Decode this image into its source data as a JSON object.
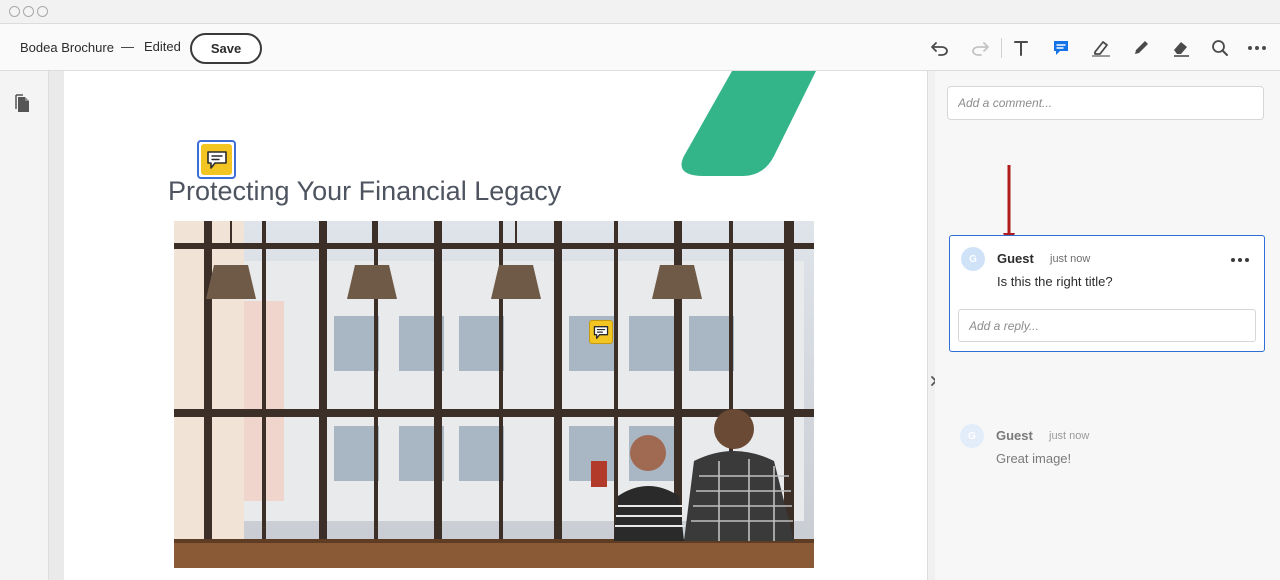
{
  "window": {
    "controls": [
      "close",
      "minimize",
      "zoom"
    ]
  },
  "toolbar": {
    "doc_name": "Bodea Brochure",
    "separator": "—",
    "status": "Edited",
    "save_label": "Save",
    "tools": [
      "undo-icon",
      "redo-icon",
      "text-icon",
      "comment-icon",
      "highlight-icon",
      "pencil-icon",
      "eraser-icon",
      "search-icon",
      "more-icon"
    ],
    "active_tool": "comment-icon",
    "accent_color": "#1473e6"
  },
  "document": {
    "title": "Protecting Your Financial Legacy",
    "accent_shape_color": "#34b489",
    "note_color": "#f3c522"
  },
  "comments_panel": {
    "add_comment_placeholder": "Add a comment...",
    "threads": [
      {
        "avatar_initial": "G",
        "author": "Guest",
        "time": "just now",
        "text": "Is this the right title?",
        "reply_placeholder": "Add a reply...",
        "selected": true
      },
      {
        "avatar_initial": "G",
        "author": "Guest",
        "time": "just now",
        "text": "Great image!",
        "selected": false
      }
    ]
  },
  "annotation_arrow_color": "#b01c1c"
}
